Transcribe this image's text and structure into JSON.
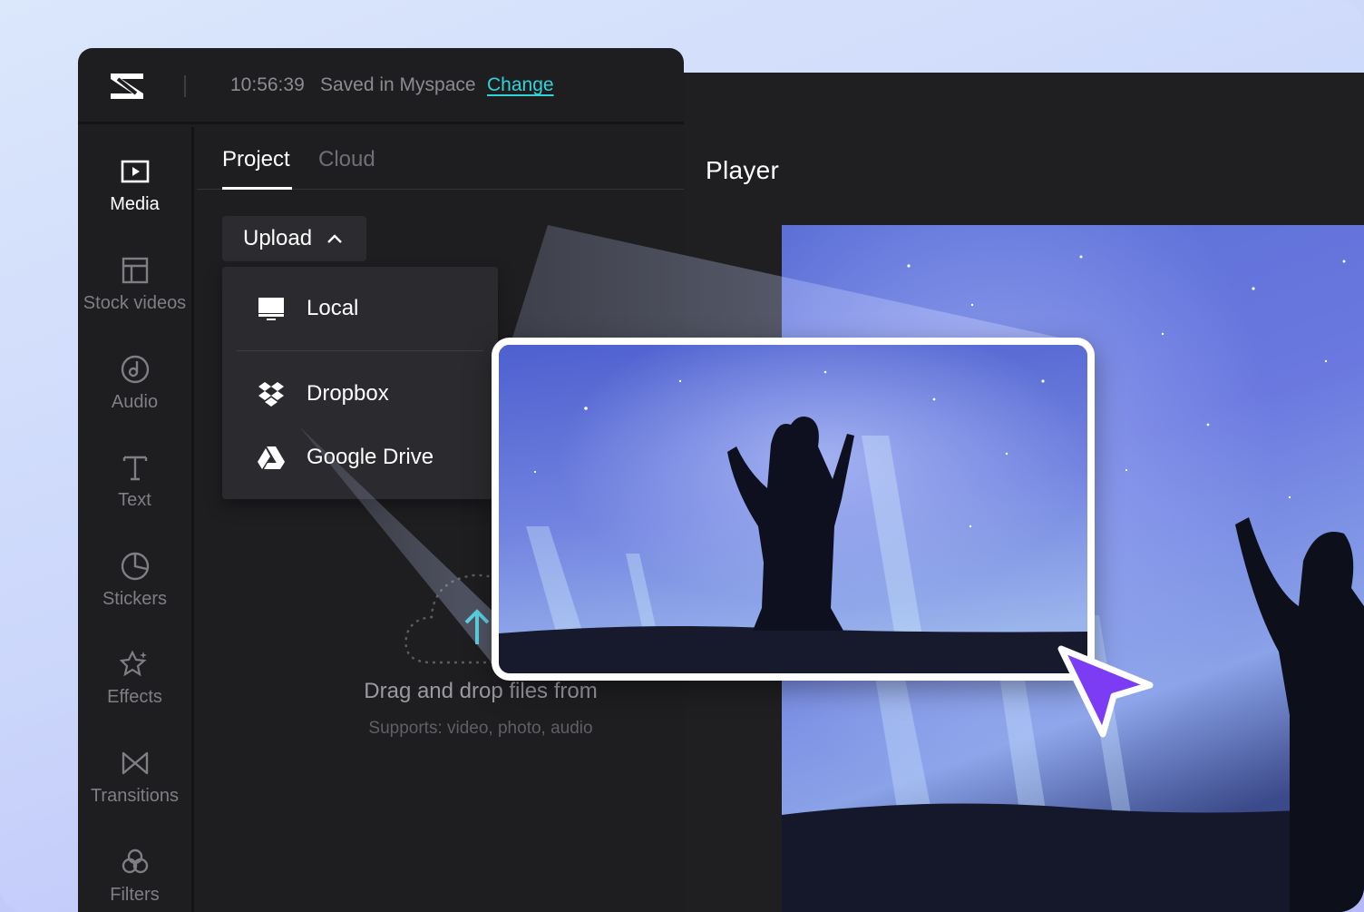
{
  "app": {
    "logo_icon": "capcut-logo-icon"
  },
  "topbar": {
    "time": "10:56:39",
    "save_status": "Saved in Myspace",
    "change_link": "Change"
  },
  "sidebar": {
    "items": [
      {
        "label": "Media",
        "icon": "media-icon",
        "active": true
      },
      {
        "label": "Stock videos",
        "icon": "stock-videos-icon",
        "active": false
      },
      {
        "label": "Audio",
        "icon": "audio-icon",
        "active": false
      },
      {
        "label": "Text",
        "icon": "text-icon",
        "active": false
      },
      {
        "label": "Stickers",
        "icon": "stickers-icon",
        "active": false
      },
      {
        "label": "Effects",
        "icon": "effects-icon",
        "active": false
      },
      {
        "label": "Transitions",
        "icon": "transitions-icon",
        "active": false
      },
      {
        "label": "Filters",
        "icon": "filters-icon",
        "active": false
      }
    ]
  },
  "tabs": [
    {
      "label": "Project",
      "active": true
    },
    {
      "label": "Cloud",
      "active": false
    }
  ],
  "upload": {
    "button_label": "Upload",
    "menu": [
      {
        "label": "Local",
        "icon": "monitor-icon"
      },
      {
        "label": "Dropbox",
        "icon": "dropbox-icon"
      },
      {
        "label": "Google Drive",
        "icon": "google-drive-icon"
      }
    ]
  },
  "drop_zone": {
    "title": "Drag and drop files from",
    "subtitle": "Supports: video, photo, audio"
  },
  "player": {
    "title": "Player"
  },
  "colors": {
    "accent": "#2fd3d8",
    "cursor": "#7b3cf4",
    "panel": "#1e1e21"
  }
}
